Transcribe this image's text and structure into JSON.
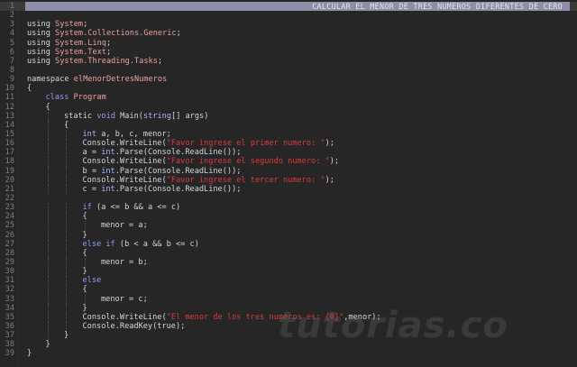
{
  "header_comment": "CALCULAR EL MENOR DE TRES NUMEROS DIFERENTES DE CERO",
  "watermark": "tutorias.co",
  "lines": [
    {
      "n": "1",
      "indent": 0,
      "tokens": []
    },
    {
      "n": "2",
      "indent": 0,
      "tokens": []
    },
    {
      "n": "3",
      "indent": 0,
      "tokens": [
        {
          "t": "using ",
          "c": "plain"
        },
        {
          "t": "System",
          "c": "ns"
        },
        {
          "t": ";",
          "c": "plain"
        }
      ]
    },
    {
      "n": "4",
      "indent": 0,
      "tokens": [
        {
          "t": "using ",
          "c": "plain"
        },
        {
          "t": "System.Collections.Generic",
          "c": "ns"
        },
        {
          "t": ";",
          "c": "plain"
        }
      ]
    },
    {
      "n": "5",
      "indent": 0,
      "tokens": [
        {
          "t": "using ",
          "c": "plain"
        },
        {
          "t": "System.Linq",
          "c": "ns"
        },
        {
          "t": ";",
          "c": "plain"
        }
      ]
    },
    {
      "n": "6",
      "indent": 0,
      "tokens": [
        {
          "t": "using ",
          "c": "plain"
        },
        {
          "t": "System.Text",
          "c": "ns"
        },
        {
          "t": ";",
          "c": "plain"
        }
      ]
    },
    {
      "n": "7",
      "indent": 0,
      "tokens": [
        {
          "t": "using ",
          "c": "plain"
        },
        {
          "t": "System.Threading.Tasks",
          "c": "ns"
        },
        {
          "t": ";",
          "c": "plain"
        }
      ]
    },
    {
      "n": "8",
      "indent": 0,
      "tokens": []
    },
    {
      "n": "9",
      "indent": 0,
      "tokens": [
        {
          "t": "namespace ",
          "c": "plain"
        },
        {
          "t": "elMenorDetresNumeros",
          "c": "ns"
        }
      ]
    },
    {
      "n": "10",
      "indent": 0,
      "tokens": [
        {
          "t": "{",
          "c": "plain"
        }
      ]
    },
    {
      "n": "11",
      "indent": 1,
      "tokens": [
        {
          "t": "class ",
          "c": "kw"
        },
        {
          "t": "Program",
          "c": "cls"
        }
      ]
    },
    {
      "n": "12",
      "indent": 1,
      "tokens": [
        {
          "t": "{",
          "c": "plain"
        }
      ]
    },
    {
      "n": "13",
      "indent": 2,
      "tokens": [
        {
          "t": "static ",
          "c": "plain"
        },
        {
          "t": "void ",
          "c": "kw"
        },
        {
          "t": "Main(",
          "c": "plain"
        },
        {
          "t": "string",
          "c": "type"
        },
        {
          "t": "[] args)",
          "c": "plain"
        }
      ]
    },
    {
      "n": "14",
      "indent": 2,
      "tokens": [
        {
          "t": "{",
          "c": "plain"
        }
      ]
    },
    {
      "n": "15",
      "indent": 3,
      "tokens": [
        {
          "t": "int ",
          "c": "type"
        },
        {
          "t": "a, b, c, menor;",
          "c": "plain"
        }
      ]
    },
    {
      "n": "16",
      "indent": 3,
      "tokens": [
        {
          "t": "Console.WriteLine(",
          "c": "plain"
        },
        {
          "t": "\"Favor ingrese el primer numero: \"",
          "c": "str"
        },
        {
          "t": ");",
          "c": "plain"
        }
      ]
    },
    {
      "n": "17",
      "indent": 3,
      "tokens": [
        {
          "t": "a = ",
          "c": "plain"
        },
        {
          "t": "int",
          "c": "type"
        },
        {
          "t": ".Parse(Console.ReadLine());",
          "c": "plain"
        }
      ]
    },
    {
      "n": "18",
      "indent": 3,
      "tokens": [
        {
          "t": "Console.WriteLine(",
          "c": "plain"
        },
        {
          "t": "\"Favor ingrese el segundo numero: \"",
          "c": "str"
        },
        {
          "t": ");",
          "c": "plain"
        }
      ]
    },
    {
      "n": "19",
      "indent": 3,
      "tokens": [
        {
          "t": "b = ",
          "c": "plain"
        },
        {
          "t": "int",
          "c": "type"
        },
        {
          "t": ".Parse(Console.ReadLine());",
          "c": "plain"
        }
      ]
    },
    {
      "n": "20",
      "indent": 3,
      "tokens": [
        {
          "t": "Console.WriteLine(",
          "c": "plain"
        },
        {
          "t": "\"Favor ingrese el tercer numero: \"",
          "c": "str"
        },
        {
          "t": ");",
          "c": "plain"
        }
      ]
    },
    {
      "n": "21",
      "indent": 3,
      "tokens": [
        {
          "t": "c = ",
          "c": "plain"
        },
        {
          "t": "int",
          "c": "type"
        },
        {
          "t": ".Parse(Console.ReadLine());",
          "c": "plain"
        }
      ]
    },
    {
      "n": "22",
      "indent": 0,
      "tokens": []
    },
    {
      "n": "23",
      "indent": 3,
      "tokens": [
        {
          "t": "if ",
          "c": "kw"
        },
        {
          "t": "(a <= b && a <= c)",
          "c": "plain"
        }
      ]
    },
    {
      "n": "24",
      "indent": 3,
      "tokens": [
        {
          "t": "{",
          "c": "plain"
        }
      ]
    },
    {
      "n": "25",
      "indent": 4,
      "tokens": [
        {
          "t": "menor = a;",
          "c": "plain"
        }
      ]
    },
    {
      "n": "26",
      "indent": 3,
      "tokens": [
        {
          "t": "}",
          "c": "plain"
        }
      ]
    },
    {
      "n": "27",
      "indent": 3,
      "tokens": [
        {
          "t": "else if ",
          "c": "kw"
        },
        {
          "t": "(b < a && b <= c)",
          "c": "plain"
        }
      ]
    },
    {
      "n": "28",
      "indent": 3,
      "tokens": [
        {
          "t": "{",
          "c": "plain"
        }
      ]
    },
    {
      "n": "29",
      "indent": 4,
      "tokens": [
        {
          "t": "menor = b;",
          "c": "plain"
        }
      ]
    },
    {
      "n": "30",
      "indent": 3,
      "tokens": [
        {
          "t": "}",
          "c": "plain"
        }
      ]
    },
    {
      "n": "31",
      "indent": 3,
      "tokens": [
        {
          "t": "else",
          "c": "kw"
        }
      ]
    },
    {
      "n": "32",
      "indent": 3,
      "tokens": [
        {
          "t": "{",
          "c": "plain"
        }
      ]
    },
    {
      "n": "33",
      "indent": 4,
      "tokens": [
        {
          "t": "menor = c;",
          "c": "plain"
        }
      ]
    },
    {
      "n": "34",
      "indent": 3,
      "tokens": [
        {
          "t": "}",
          "c": "plain"
        }
      ]
    },
    {
      "n": "35",
      "indent": 3,
      "tokens": [
        {
          "t": "Console.WriteLine(",
          "c": "plain"
        },
        {
          "t": "\"El menor de los tres numeros es: {0}\"",
          "c": "str"
        },
        {
          "t": ",menor);",
          "c": "plain"
        }
      ]
    },
    {
      "n": "36",
      "indent": 3,
      "tokens": [
        {
          "t": "Console.ReadKey(true);",
          "c": "plain"
        }
      ]
    },
    {
      "n": "37",
      "indent": 2,
      "tokens": [
        {
          "t": "}",
          "c": "plain"
        }
      ]
    },
    {
      "n": "38",
      "indent": 1,
      "tokens": [
        {
          "t": "}",
          "c": "plain"
        }
      ]
    },
    {
      "n": "39",
      "indent": 0,
      "tokens": [
        {
          "t": "}",
          "c": "plain"
        }
      ]
    }
  ],
  "colors": {
    "background": "#262626",
    "keyword": "#8f9cf5",
    "namespace": "#eaa1a1",
    "string": "#d83a3a",
    "comment_bar": "#8c8fa6"
  }
}
